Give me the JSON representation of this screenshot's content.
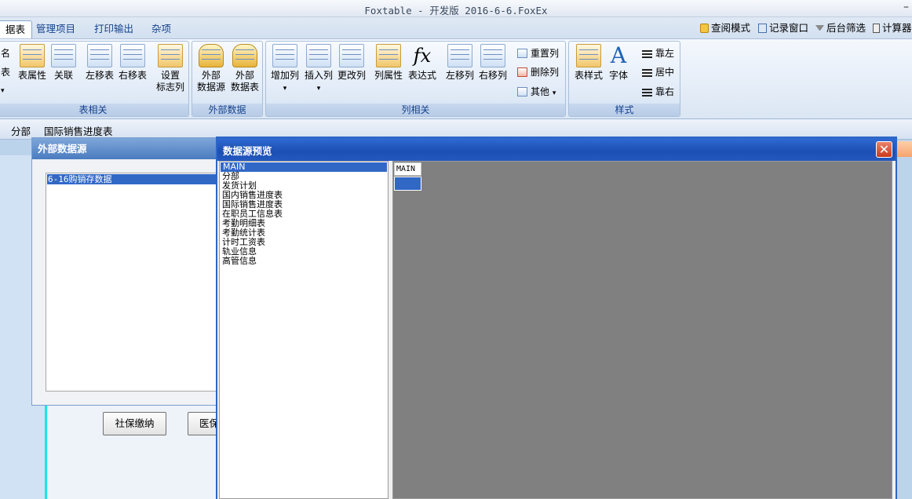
{
  "window": {
    "title": "Foxtable - 开发版 2016-6-6.FoxEx",
    "minimize": "–"
  },
  "ribbon_tabs": [
    "据表",
    "管理项目",
    "打印输出",
    "杂项"
  ],
  "quick_access": [
    "查阅模式",
    "记录窗口",
    "后台筛选",
    "计算器"
  ],
  "groups": {
    "table": {
      "label": "表相关",
      "partial": [
        "名",
        "表"
      ],
      "buttons": [
        "表属性",
        "关联",
        "左移表",
        "右移表"
      ],
      "setting": [
        "设置",
        "标志列"
      ]
    },
    "external": {
      "label": "外部数据",
      "buttons": [
        [
          "外部",
          "数据源"
        ],
        [
          "外部",
          "数据表"
        ]
      ]
    },
    "columns": {
      "label": "列相关",
      "buttons": [
        "增加列",
        "插入列",
        "更改列",
        "列属性",
        "表达式",
        "左移列",
        "右移列"
      ],
      "small": [
        "重置列",
        "删除列",
        "其他"
      ]
    },
    "style": {
      "label": "样式",
      "buttons": [
        "表样式",
        "字体"
      ],
      "align": [
        "靠左",
        "居中",
        "靠右"
      ]
    }
  },
  "doc_tabs": [
    "分部",
    "国际销售进度表"
  ],
  "ext_dialog": {
    "title": "外部数据源",
    "selected": "6-16购销存数据",
    "buttons": [
      "社保缴纳",
      "医保"
    ]
  },
  "preview_dialog": {
    "title": "数据源预览",
    "tables": [
      "MAIN",
      "分部",
      "发货计划",
      "国内销售进度表",
      "国际销售进度表",
      "在职员工信息表",
      "考勤明细表",
      "考勤统计表",
      "计时工资表",
      "轨业信息",
      "高管信息"
    ],
    "column_header": "MAIN"
  }
}
